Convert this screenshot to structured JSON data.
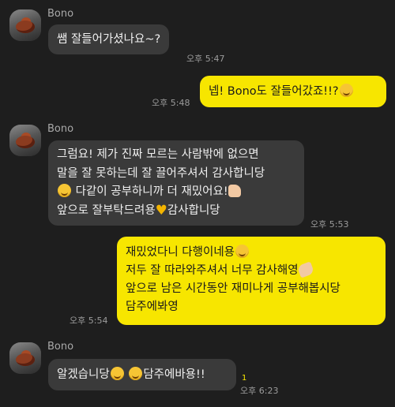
{
  "messages": [
    {
      "sender": "Bono",
      "text": "쌤 잘들어가셨나요~?",
      "time": "오후 5:47"
    },
    {
      "text_prefix": "넵! Bono도 잘들어갔죠!!?",
      "time": "오후 5:48"
    },
    {
      "sender": "Bono",
      "line1": "그럼요! 제가 진짜 모르는 사람밖에 없으면",
      "line2": "말을 잘 못하는데 잘 끌어주셔서 감사합니당",
      "line3": "다같이 공부하니까 더 재밌어요!",
      "line4a": "앞으로 잘부탁드려용",
      "line4b": "감사합니당",
      "time": "오후 5:53"
    },
    {
      "line1": "재밌었다니 다행이네용",
      "line2": "저두 잘 따라와주셔서 너무 감사해영",
      "line3": "앞으로 남은 시간동안 재미나게 공부해봅시당",
      "line4": "담주에봐영",
      "time": "오후 5:54"
    },
    {
      "sender": "Bono",
      "text_a": "알겠습니당",
      "text_b": "담주에바용!!",
      "time": "오후 6:23",
      "unread": "1"
    }
  ],
  "emoji": {
    "smile": "grinning-squint-face",
    "heart": "yellow-heart",
    "thumb": "thumbs-up",
    "clap": "clapping-hands"
  },
  "colors": {
    "background": "#1e1e1e",
    "received_bubble": "#3a3a3a",
    "sent_bubble": "#f7e600"
  }
}
